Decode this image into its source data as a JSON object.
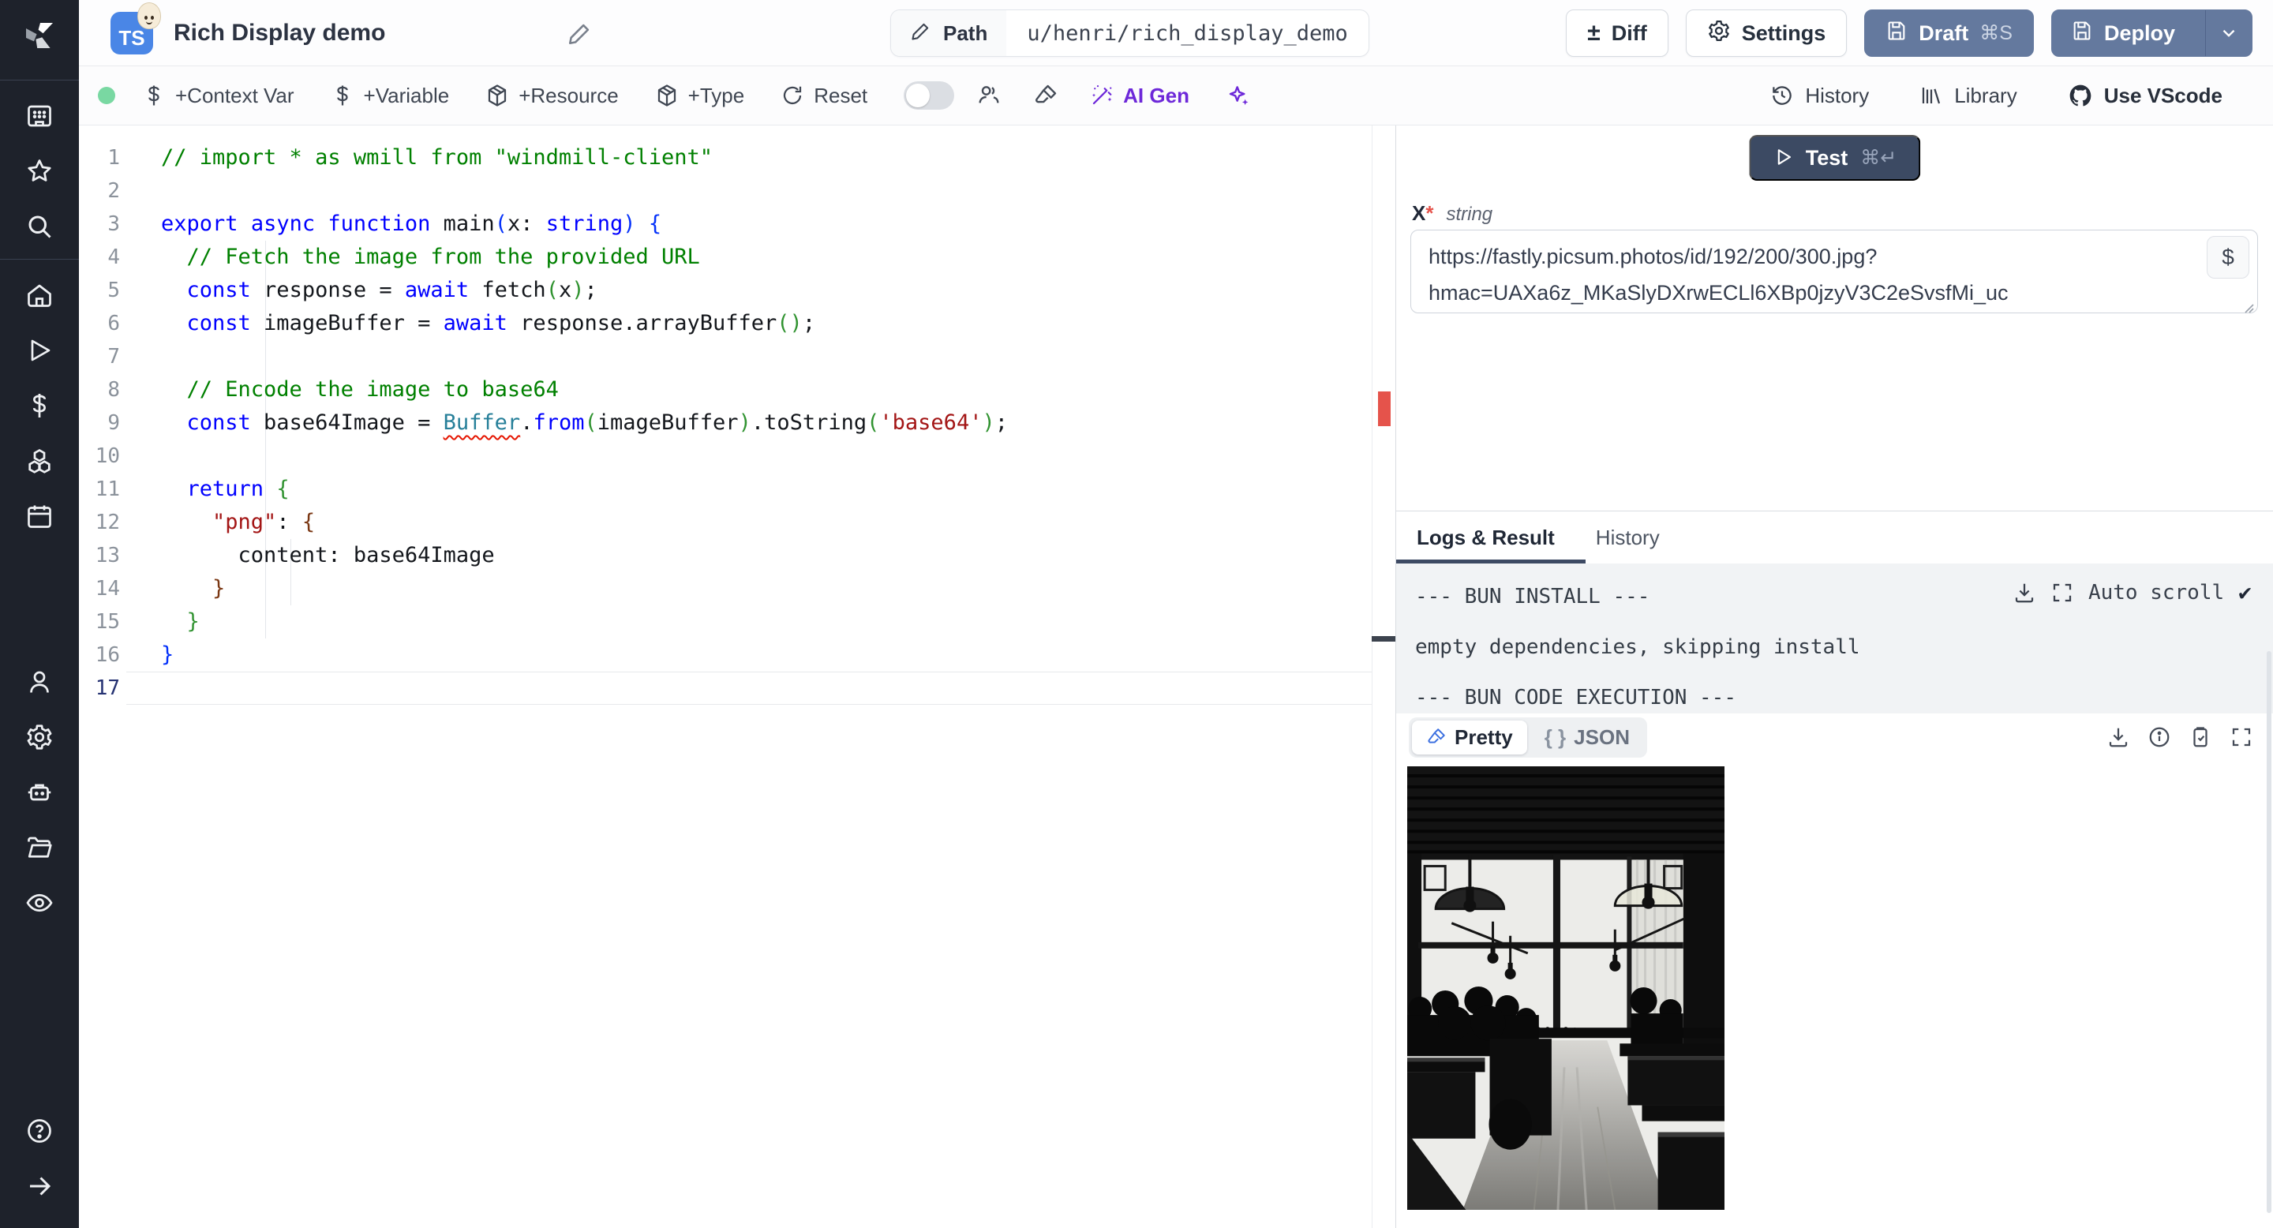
{
  "topbar": {
    "lang_badge": "TS",
    "title": "Rich Display demo",
    "path_label": "Path",
    "path_value": "u/henri/rich_display_demo",
    "diff_label": "Diff",
    "diff_glyph": "±",
    "settings_label": "Settings",
    "draft_label": "Draft",
    "draft_kbd": "⌘S",
    "deploy_label": "Deploy"
  },
  "toolbar": {
    "context_var": "+Context Var",
    "variable": "+Variable",
    "resource": "+Resource",
    "type": "+Type",
    "reset": "Reset",
    "ai_gen": "AI Gen",
    "history": "History",
    "library": "Library",
    "use_vscode": "Use VScode"
  },
  "editor": {
    "active_line": 17,
    "lines": [
      {
        "n": 1,
        "tokens": [
          [
            "c",
            "// import * as wmill from \"windmill-client\""
          ]
        ]
      },
      {
        "n": 2,
        "tokens": []
      },
      {
        "n": 3,
        "tokens": [
          [
            "k",
            "export"
          ],
          [
            "p",
            " "
          ],
          [
            "k",
            "async"
          ],
          [
            "p",
            " "
          ],
          [
            "k",
            "function"
          ],
          [
            "p",
            " main"
          ],
          [
            "b1",
            "("
          ],
          [
            "p",
            "x"
          ],
          [
            "p",
            ": "
          ],
          [
            "k",
            "string"
          ],
          [
            "b1",
            ")"
          ],
          [
            "p",
            " "
          ],
          [
            "b1",
            "{"
          ]
        ]
      },
      {
        "n": 4,
        "tokens": [
          [
            "c",
            "  // Fetch the image from the provided URL"
          ]
        ]
      },
      {
        "n": 5,
        "tokens": [
          [
            "p",
            "  "
          ],
          [
            "k",
            "const"
          ],
          [
            "p",
            " response = "
          ],
          [
            "k",
            "await"
          ],
          [
            "p",
            " fetch"
          ],
          [
            "b2",
            "("
          ],
          [
            "p",
            "x"
          ],
          [
            "b2",
            ")"
          ],
          [
            "p",
            ";"
          ]
        ]
      },
      {
        "n": 6,
        "tokens": [
          [
            "p",
            "  "
          ],
          [
            "k",
            "const"
          ],
          [
            "p",
            " imageBuffer = "
          ],
          [
            "k",
            "await"
          ],
          [
            "p",
            " response.arrayBuffer"
          ],
          [
            "b2",
            "()"
          ],
          [
            "p",
            ";"
          ]
        ]
      },
      {
        "n": 7,
        "tokens": []
      },
      {
        "n": 8,
        "tokens": [
          [
            "c",
            "  // Encode the image to base64"
          ]
        ]
      },
      {
        "n": 9,
        "tokens": [
          [
            "p",
            "  "
          ],
          [
            "k",
            "const"
          ],
          [
            "p",
            " base64Image = "
          ],
          [
            "e",
            "Buffer"
          ],
          [
            "p",
            "."
          ],
          [
            "k",
            "from"
          ],
          [
            "b2",
            "("
          ],
          [
            "p",
            "imageBuffer"
          ],
          [
            "b2",
            ")"
          ],
          [
            "p",
            ".toString"
          ],
          [
            "b2",
            "("
          ],
          [
            "s",
            "'base64'"
          ],
          [
            "b2",
            ")"
          ],
          [
            "p",
            ";"
          ]
        ]
      },
      {
        "n": 10,
        "tokens": []
      },
      {
        "n": 11,
        "tokens": [
          [
            "p",
            "  "
          ],
          [
            "k",
            "return"
          ],
          [
            "p",
            " "
          ],
          [
            "b2",
            "{"
          ]
        ]
      },
      {
        "n": 12,
        "tokens": [
          [
            "p",
            "    "
          ],
          [
            "s",
            "\"png\""
          ],
          [
            "p",
            ": "
          ],
          [
            "b3",
            "{"
          ]
        ]
      },
      {
        "n": 13,
        "tokens": [
          [
            "p",
            "      content: base64Image"
          ]
        ]
      },
      {
        "n": 14,
        "tokens": [
          [
            "p",
            "    "
          ],
          [
            "b3",
            "}"
          ]
        ]
      },
      {
        "n": 15,
        "tokens": [
          [
            "p",
            "  "
          ],
          [
            "b2",
            "}"
          ]
        ]
      },
      {
        "n": 16,
        "tokens": [
          [
            "b1",
            "}"
          ]
        ]
      },
      {
        "n": 17,
        "tokens": []
      }
    ]
  },
  "right_panel": {
    "test_label": "Test",
    "test_kbd": "⌘↵",
    "arg": {
      "name": "X",
      "required_mark": "*",
      "type": "string",
      "value": "https://fastly.picsum.photos/id/192/200/300.jpg?hmac=UAXa6z_MKaSlyDXrwECLl6XBp0jzyV3C2eSvsfMi_uc",
      "dollar_label": "$"
    },
    "tabs": {
      "logs": "Logs & Result",
      "history": "History"
    },
    "logs": [
      "--- BUN INSTALL ---",
      "empty dependencies, skipping install",
      "--- BUN CODE EXECUTION ---"
    ],
    "auto_scroll_label": "Auto scroll",
    "auto_scroll_check": "✔",
    "result_view": {
      "pretty": "Pretty",
      "json": "JSON",
      "json_braces": "{ }"
    }
  },
  "colors": {
    "accent_slate": "#64799e",
    "test_navy": "#3c4a63",
    "ai_purple": "#6d28d9",
    "error_red": "#e5534b",
    "status_green": "#79d8a2",
    "ts_badge_blue": "#4a86e6"
  }
}
